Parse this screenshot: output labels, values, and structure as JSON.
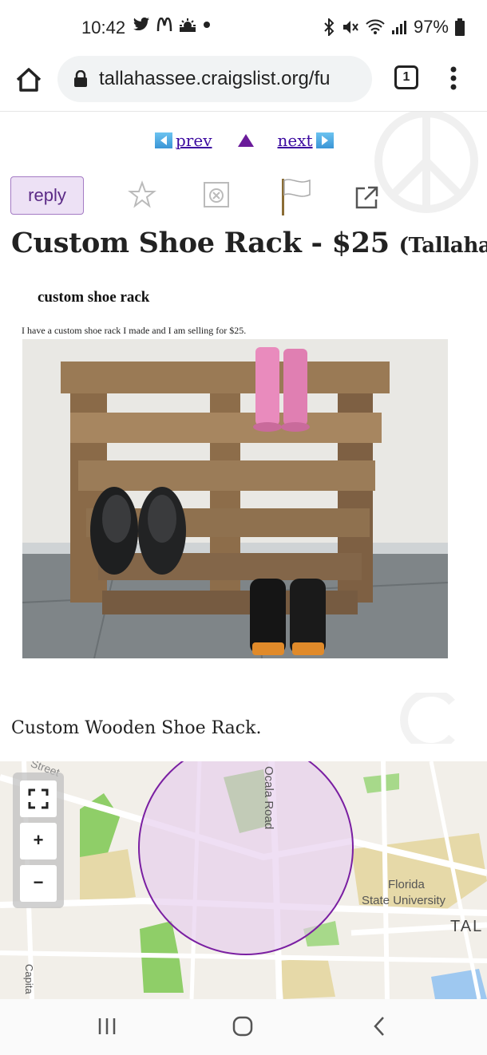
{
  "status_bar": {
    "time": "10:42",
    "battery": "97%",
    "icons_left": [
      "twitter-icon",
      "mcdonalds-icon",
      "weather-icon",
      "dot-icon"
    ],
    "icons_right": [
      "bluetooth-icon",
      "mute-icon",
      "wifi-icon",
      "signal-icon",
      "battery-icon"
    ]
  },
  "browser": {
    "url": "tallahassee.craigslist.org/fu",
    "tab_count": "1"
  },
  "nav": {
    "prev_label": "prev",
    "next_label": "next"
  },
  "actions": {
    "reply_label": "reply",
    "icons": [
      "star-icon",
      "hide-icon",
      "flag-icon",
      "share-icon"
    ]
  },
  "post": {
    "title": "Custom Shoe Rack - $25",
    "location": "(Tallahassee)",
    "image_heading": "custom shoe rack",
    "image_caption": "I have a custom shoe rack I made and I am selling for $25.",
    "description": "Custom Wooden Shoe Rack."
  },
  "map": {
    "labels": {
      "street": "Street",
      "ocala": "Ocala Road",
      "fsu_line1": "Florida",
      "fsu_line2": "State University",
      "tal": "TAL",
      "capital": "Capita"
    },
    "controls": [
      "fullscreen-icon",
      "zoom-in-icon",
      "zoom-out-icon"
    ],
    "zoom_in": "+",
    "zoom_out": "−",
    "colors": {
      "area_fill": "#e5c9ec",
      "area_border": "#7a1fa2",
      "park": "#8fce68",
      "land": "#f2efe9"
    }
  },
  "system_nav": [
    "recents-icon",
    "home-circle-icon",
    "back-icon"
  ]
}
